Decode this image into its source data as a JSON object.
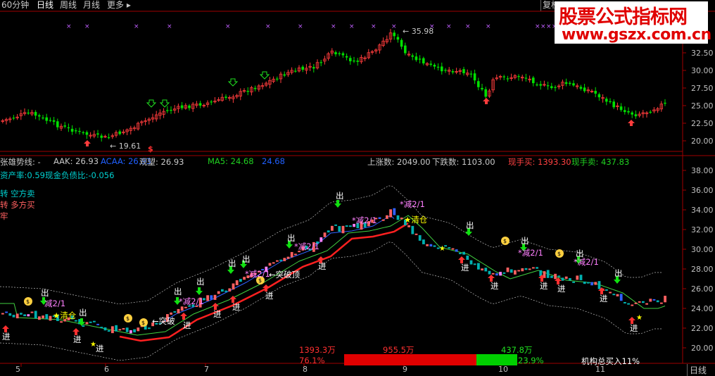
{
  "toolbar": {
    "items": [
      "60分钟",
      "日线",
      "周线",
      "月线",
      "更多 ▸"
    ],
    "active": "日线",
    "fuquan": "复权"
  },
  "watermark": {
    "line1": "股票公式指标网",
    "line2": "www.gszx.com.cn"
  },
  "price_chart": {
    "y_ticks": [
      "35.00",
      "32.50",
      "30.00",
      "27.50",
      "25.00",
      "22.50",
      "20.00"
    ],
    "high_label": "35.98",
    "low_label": "19.61",
    "colors": {
      "up": "#ff3c3c",
      "down": "#00e000",
      "grid": "#a00000"
    }
  },
  "info_bar": {
    "title": "张雄势线:",
    "dash": "-",
    "aak_label": "AAK:",
    "aak_value": "26.93",
    "acaa_label": "ACAA:",
    "acaa_value": "26.93",
    "guanwang_label": "观望:",
    "guanwang_value": "26.93",
    "ma5_label": "MA5:",
    "ma5_value": "24.68",
    "ma5_extra": "24.68",
    "up_label": "上涨数:",
    "up_value": "2049.00",
    "down_label": "下跌数:",
    "down_value": "1103.00",
    "xianshoumai_label": "现手买:",
    "xianshoumai_value": "1393.30",
    "xianshoumai2_label": "现手卖:",
    "xianshoumai2_value": "437.83"
  },
  "info_bar2": "资产率:0.59现金负债比:-0.056",
  "legend": [
    {
      "text": "转 空方卖",
      "color": "#00d0d0"
    },
    {
      "text": "转 多方买",
      "color": "#ff6060"
    },
    {
      "text": "牢",
      "color": "#ff6060"
    }
  ],
  "indicator_chart": {
    "y_ticks": [
      "38.00",
      "36.00",
      "34.00",
      "32.00",
      "30.00",
      "28.00",
      "26.00",
      "24.00",
      "22.00",
      "20.00"
    ]
  },
  "annotations": {
    "chu": "出",
    "jin": "进",
    "jian": "减2/1",
    "jian_star": "*减2/1",
    "qingcang": "清仓",
    "tupo": "突破",
    "tupoding": "突破顶"
  },
  "bottom": {
    "buy_amount": "1393.3万",
    "mid_amount": "955.5万",
    "sell_amount": "437.8万",
    "buy_pct": "76.1%",
    "sell_pct": "23.9%",
    "inst": "机构总买入11%",
    "buy_pct_value": 76.1
  },
  "x_ticks": [
    "5",
    "6",
    "7",
    "8",
    "9",
    "10",
    "11"
  ],
  "period_label": "日线"
}
